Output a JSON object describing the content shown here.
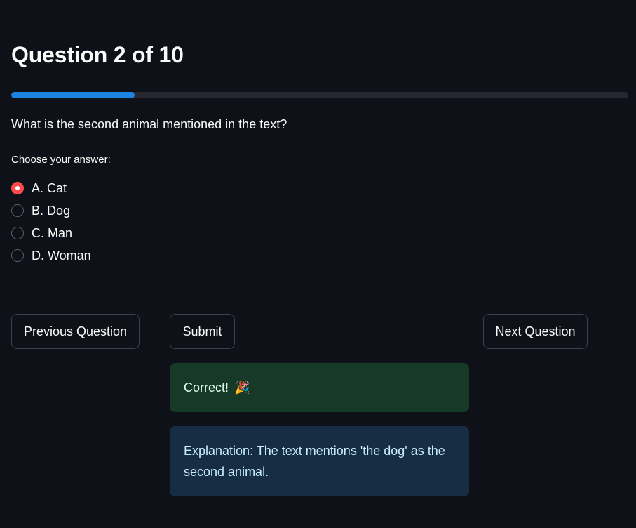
{
  "quiz": {
    "title": "Question 2 of 10",
    "progress_fraction": 0.2,
    "question_text": "What is the second animal mentioned in the text?",
    "choose_label": "Choose your answer:",
    "options": [
      {
        "label": "A. Cat",
        "selected": true
      },
      {
        "label": "B. Dog",
        "selected": false
      },
      {
        "label": "C. Man",
        "selected": false
      },
      {
        "label": "D. Woman",
        "selected": false
      }
    ],
    "selected_index": 0
  },
  "buttons": {
    "previous_label": "Previous Question",
    "submit_label": "Submit",
    "next_label": "Next Question"
  },
  "feedback": {
    "result_text": "Correct!",
    "result_emoji": "🎉",
    "explanation_text": "Explanation: The text mentions 'the dog' as the second animal."
  },
  "colors": {
    "background": "#0e1117",
    "progress_fill": "#1c83e1",
    "radio_selected": "#ff4b4b",
    "success_bg": "#173928",
    "info_bg": "#172d43"
  },
  "icons": {
    "result_icon": "party-popper-icon"
  }
}
